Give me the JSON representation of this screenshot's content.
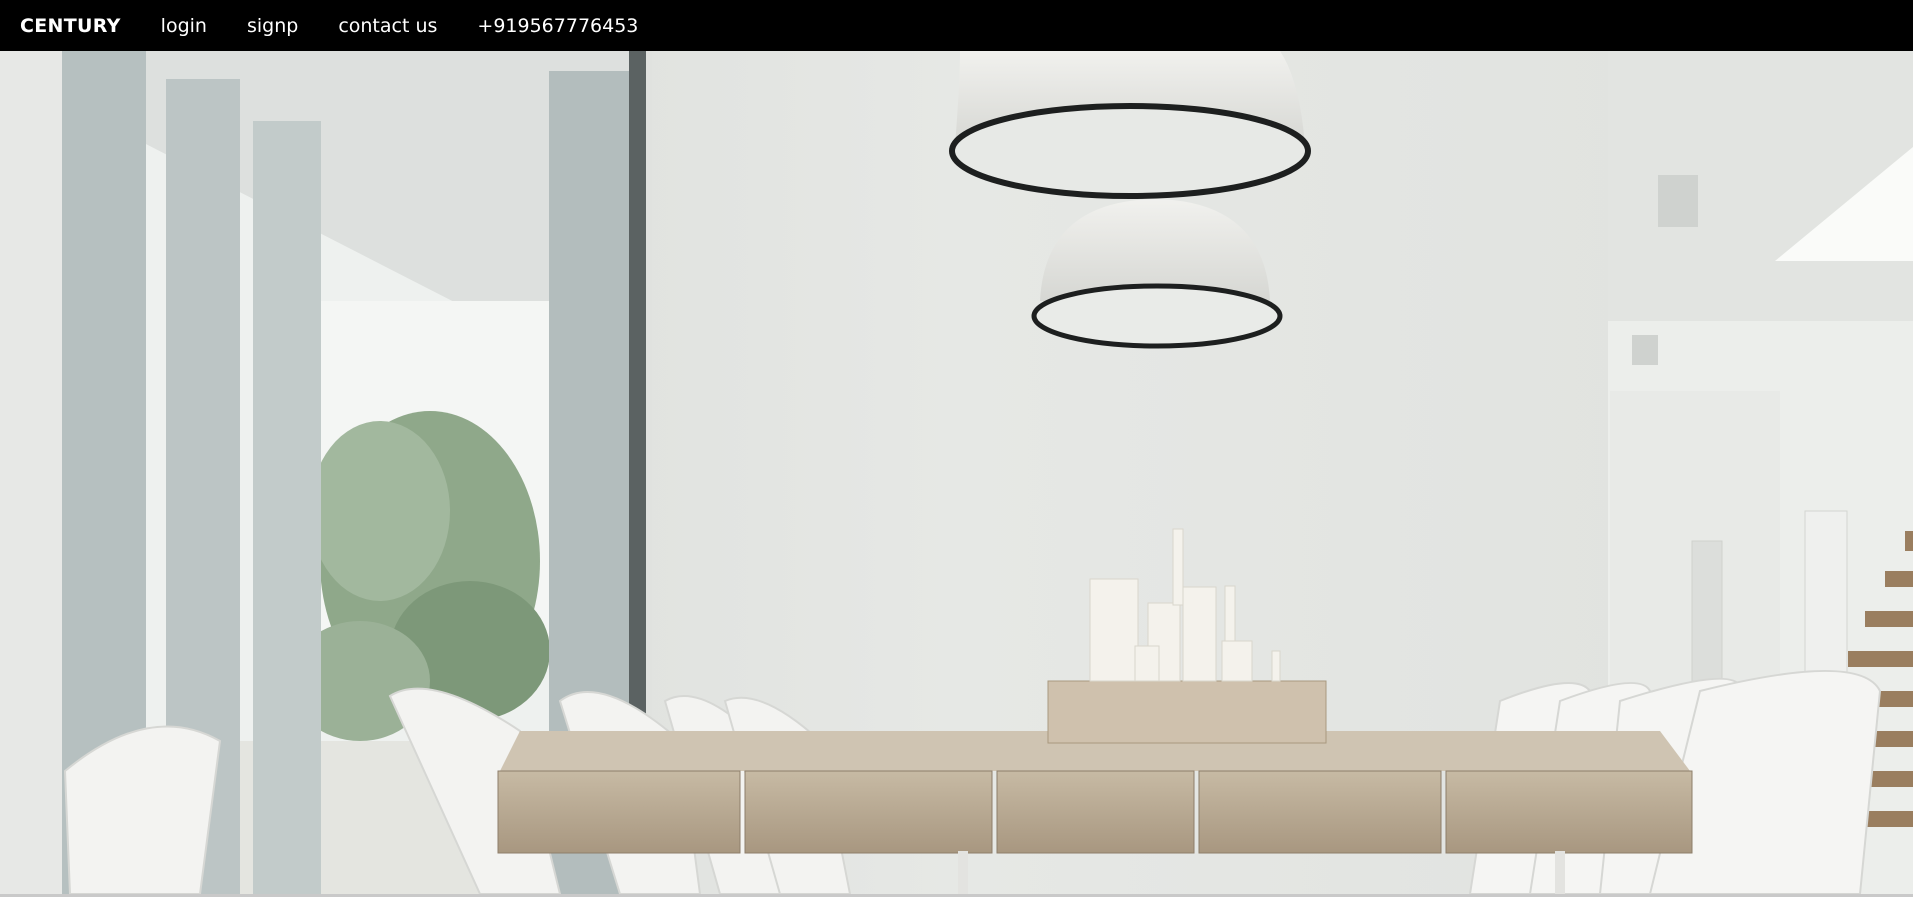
{
  "nav": {
    "brand": "CENTURY",
    "login": "login",
    "signup": "signp",
    "contact": "contact us",
    "phone": "+919567776453"
  },
  "hero": {
    "image_subject": "minimalist white dining room with wooden table, pendant lamps and candles"
  },
  "colors": {
    "topbar": "#000000",
    "nav_text": "#ffffff",
    "wall": "#e4e6e3",
    "wood": "#b6a78f"
  }
}
